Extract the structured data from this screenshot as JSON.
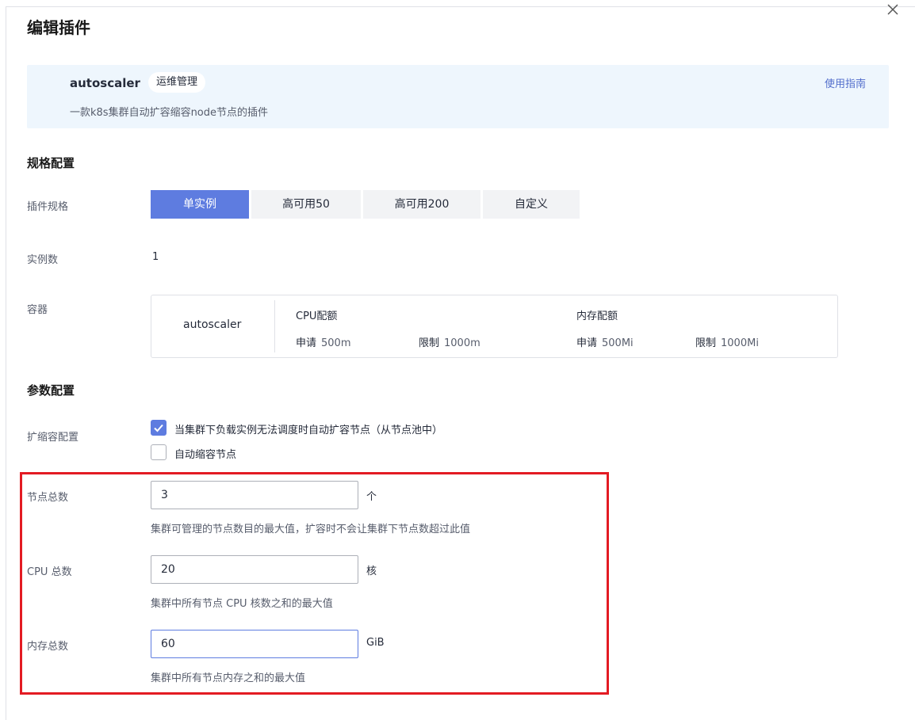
{
  "dialog": {
    "title": "编辑插件"
  },
  "plugin": {
    "name": "autoscaler",
    "tag": "运维管理",
    "description": "一款k8s集群自动扩容缩容node节点的插件",
    "guide_link": "使用指南"
  },
  "spec_section": {
    "title": "规格配置",
    "spec_label": "插件规格",
    "options": [
      "单实例",
      "高可用50",
      "高可用200",
      "自定义"
    ],
    "selected": "单实例",
    "instances_label": "实例数",
    "instances_value": "1",
    "container_label": "容器",
    "container": {
      "name": "autoscaler",
      "cpu_title": "CPU配额",
      "mem_title": "内存配额",
      "request_label": "申请",
      "limit_label": "限制",
      "cpu_request": "500m",
      "cpu_limit": "1000m",
      "mem_request": "500Mi",
      "mem_limit": "1000Mi"
    }
  },
  "param_section": {
    "title": "参数配置",
    "scale_label": "扩缩容配置",
    "checkboxes": [
      {
        "label": "当集群下负载实例无法调度时自动扩容节点（从节点池中）",
        "checked": true
      },
      {
        "label": "自动缩容节点",
        "checked": false
      }
    ],
    "fields": [
      {
        "label": "节点总数",
        "value": "3",
        "unit": "个",
        "hint": "集群可管理的节点数目的最大值，扩容时不会让集群下节点数超过此值"
      },
      {
        "label": "CPU 总数",
        "value": "20",
        "unit": "核",
        "hint": "集群中所有节点 CPU 核数之和的最大值"
      },
      {
        "label": "内存总数",
        "value": "60",
        "unit": "GiB",
        "hint": "集群中所有节点内存之和的最大值"
      }
    ]
  },
  "colors": {
    "accent": "#5e7ce0",
    "highlight_frame": "#e31b23",
    "info_bg": "#eef6fd",
    "link": "#526ecc"
  },
  "icons": {
    "close": "close-icon",
    "check": "check-icon"
  }
}
